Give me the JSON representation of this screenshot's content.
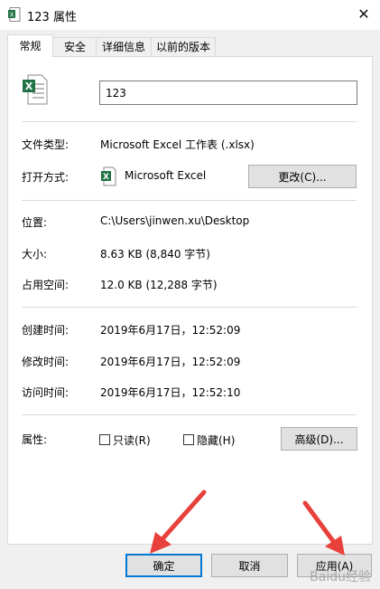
{
  "window": {
    "title": "123 属性",
    "close_icon": "close-icon"
  },
  "tabs": [
    {
      "label": "常规",
      "active": true
    },
    {
      "label": "安全",
      "active": false
    },
    {
      "label": "详细信息",
      "active": false
    },
    {
      "label": "以前的版本",
      "active": false
    }
  ],
  "general": {
    "file_name_value": "123",
    "file_type_label": "文件类型:",
    "file_type_value": "Microsoft Excel 工作表 (.xlsx)",
    "opens_with_label": "打开方式:",
    "opens_with_value": "Microsoft Excel",
    "change_button": "更改(C)...",
    "location_label": "位置:",
    "location_value": "C:\\Users\\jinwen.xu\\Desktop",
    "size_label": "大小:",
    "size_value": "8.63 KB (8,840 字节)",
    "size_on_disk_label": "占用空间:",
    "size_on_disk_value": "12.0 KB (12,288 字节)",
    "created_label": "创建时间:",
    "created_value": "2019年6月17日，12:52:09",
    "modified_label": "修改时间:",
    "modified_value": "2019年6月17日，12:52:09",
    "accessed_label": "访问时间:",
    "accessed_value": "2019年6月17日，12:52:10",
    "attributes_label": "属性:",
    "readonly_label": "只读(R)",
    "readonly_checked": false,
    "hidden_label": "隐藏(H)",
    "hidden_checked": false,
    "advanced_button": "高级(D)..."
  },
  "footer": {
    "ok_button": "确定",
    "cancel_button": "取消",
    "apply_button": "应用(A)"
  },
  "annotations": {
    "arrow_color": "#e8403a"
  },
  "watermark": "Baidu经验",
  "colors": {
    "excel_green": "#217346",
    "accent": "#0078d7"
  }
}
